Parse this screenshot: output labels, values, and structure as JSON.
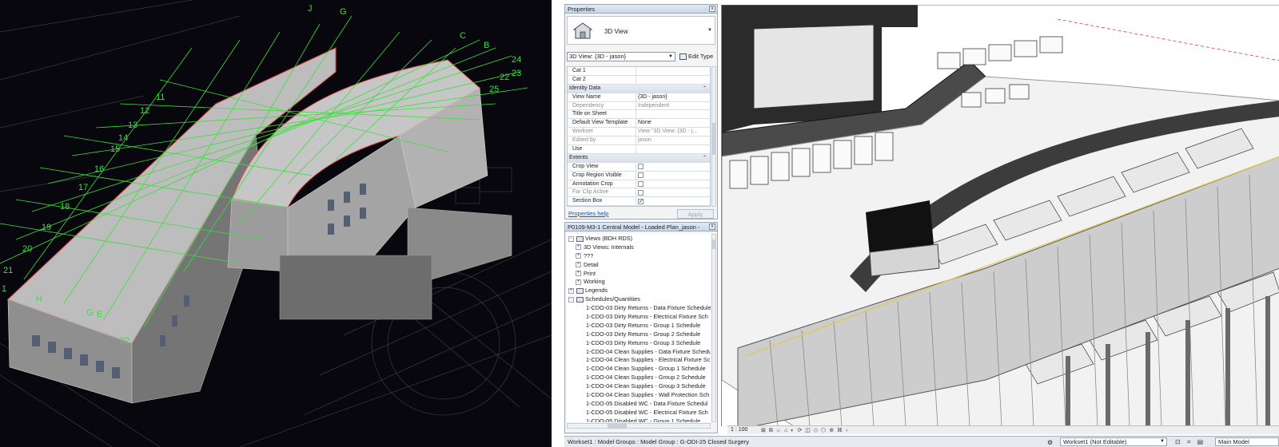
{
  "properties": {
    "title": "Properties",
    "close_label": "x",
    "type_name": "3D View",
    "view_selector": "3D View: {3D - jason}",
    "edit_type_label": "Edit Type",
    "rows": [
      {
        "kind": "row",
        "label": "Cat 1",
        "value": ""
      },
      {
        "kind": "row",
        "label": "Cat 2",
        "value": ""
      },
      {
        "kind": "group",
        "label": "Identity Data"
      },
      {
        "kind": "row",
        "label": "View Name",
        "value": "{3D - jason}"
      },
      {
        "kind": "row",
        "label": "Dependency",
        "value": "Independent",
        "dim": true
      },
      {
        "kind": "row",
        "label": "Title on Sheet",
        "value": ""
      },
      {
        "kind": "row",
        "label": "Default View Template",
        "value": "None"
      },
      {
        "kind": "row",
        "label": "Workset",
        "value": "View \"3D View: {3D - j...",
        "dim": true
      },
      {
        "kind": "row",
        "label": "Edited by",
        "value": "jason",
        "dim": true
      },
      {
        "kind": "row",
        "label": "Use",
        "value": ""
      },
      {
        "kind": "group",
        "label": "Extents"
      },
      {
        "kind": "check",
        "label": "Crop View",
        "checked": false
      },
      {
        "kind": "check",
        "label": "Crop Region Visible",
        "checked": false
      },
      {
        "kind": "check",
        "label": "Annotation Crop",
        "checked": false
      },
      {
        "kind": "check",
        "label": "Far Clip Active",
        "checked": false,
        "dim": true
      },
      {
        "kind": "check",
        "label": "Section Box",
        "checked": true
      }
    ],
    "help_link": "Properties help",
    "apply_label": "Apply"
  },
  "browser": {
    "title": "P0109-M3-1 Central Model - Loaded Plan_jason - Proj...",
    "close_label": "x",
    "nodes": [
      {
        "level": 0,
        "toggle": "-",
        "icon": true,
        "label": "Views (BDH RDS)"
      },
      {
        "level": 1,
        "toggle": "+",
        "label": "3D Views: Internals"
      },
      {
        "level": 1,
        "toggle": "+",
        "label": "???"
      },
      {
        "level": 1,
        "toggle": "+",
        "label": "Detail"
      },
      {
        "level": 1,
        "toggle": "+",
        "label": "Print"
      },
      {
        "level": 1,
        "toggle": "+",
        "label": "Working"
      },
      {
        "level": 0,
        "toggle": "+",
        "icon": true,
        "label": "Legends"
      },
      {
        "level": 0,
        "toggle": "-",
        "icon": true,
        "label": "Schedules/Quantities"
      },
      {
        "level": 2,
        "label": "1-CDO-03 Dirty Returns - Data Fixture Schedule"
      },
      {
        "level": 2,
        "label": "1-CDO-03 Dirty Returns - Electrical Fixture Sch"
      },
      {
        "level": 2,
        "label": "1-CDO-03 Dirty Returns - Group 1 Schedule"
      },
      {
        "level": 2,
        "label": "1-CDO-03 Dirty Returns - Group 2 Schedule"
      },
      {
        "level": 2,
        "label": "1-CDO-03 Dirty Returns - Group 3 Schedule"
      },
      {
        "level": 2,
        "label": "1-CDO-04 Clean Supplies - Data Fixture Schedu"
      },
      {
        "level": 2,
        "label": "1-CDO-04 Clean Supplies - Electrical Fixture Sc"
      },
      {
        "level": 2,
        "label": "1-CDO-04 Clean Supplies - Group 1 Schedule"
      },
      {
        "level": 2,
        "label": "1-CDO-04 Clean Supplies - Group 2 Schedule"
      },
      {
        "level": 2,
        "label": "1-CDO-04 Clean Supplies - Group 3 Schedule"
      },
      {
        "level": 2,
        "label": "1-CDO-04 Clean Supplies - Wall Protection Sch"
      },
      {
        "level": 2,
        "label": "1-CDO-05 Disabled WC - Data Fixture Schedul"
      },
      {
        "level": 2,
        "label": "1-CDO-05 Disabled WC - Electrical Fixture Sch"
      },
      {
        "level": 2,
        "label": "1-CDO-05 Disabled WC - Group 1 Schedule"
      }
    ]
  },
  "viewbar": {
    "scale": "1 : 100",
    "icons": "⊠ ⧉ ☼ ⌂ ◐ ⟳ ◫ ◇ ⬡ ⊕ ⌘ ‹"
  },
  "status": {
    "message": "Workset1 : Model Groups : Model Group : G-ODI-25 Closed Surgery",
    "workset_icon": "⚙",
    "workset": "Workset1 (Not Editable)",
    "tools": "⊡ ⌗ ▤",
    "model": "Main Model"
  },
  "cad_labels": {
    "grid_numbers": [
      "11",
      "12",
      "13",
      "14",
      "15",
      "16",
      "17",
      "18",
      "19",
      "20",
      "21",
      "1",
      "22"
    ],
    "grid_letters": [
      "J",
      "G",
      "C",
      "B",
      "H",
      "G",
      "E"
    ],
    "right_numbers": [
      "24",
      "25",
      "23",
      "22"
    ]
  },
  "colors": {
    "cad_background": "#07070d",
    "grid_green": "#38e038",
    "accent_red": "#e34545",
    "panel_border": "#9aa8b8"
  }
}
